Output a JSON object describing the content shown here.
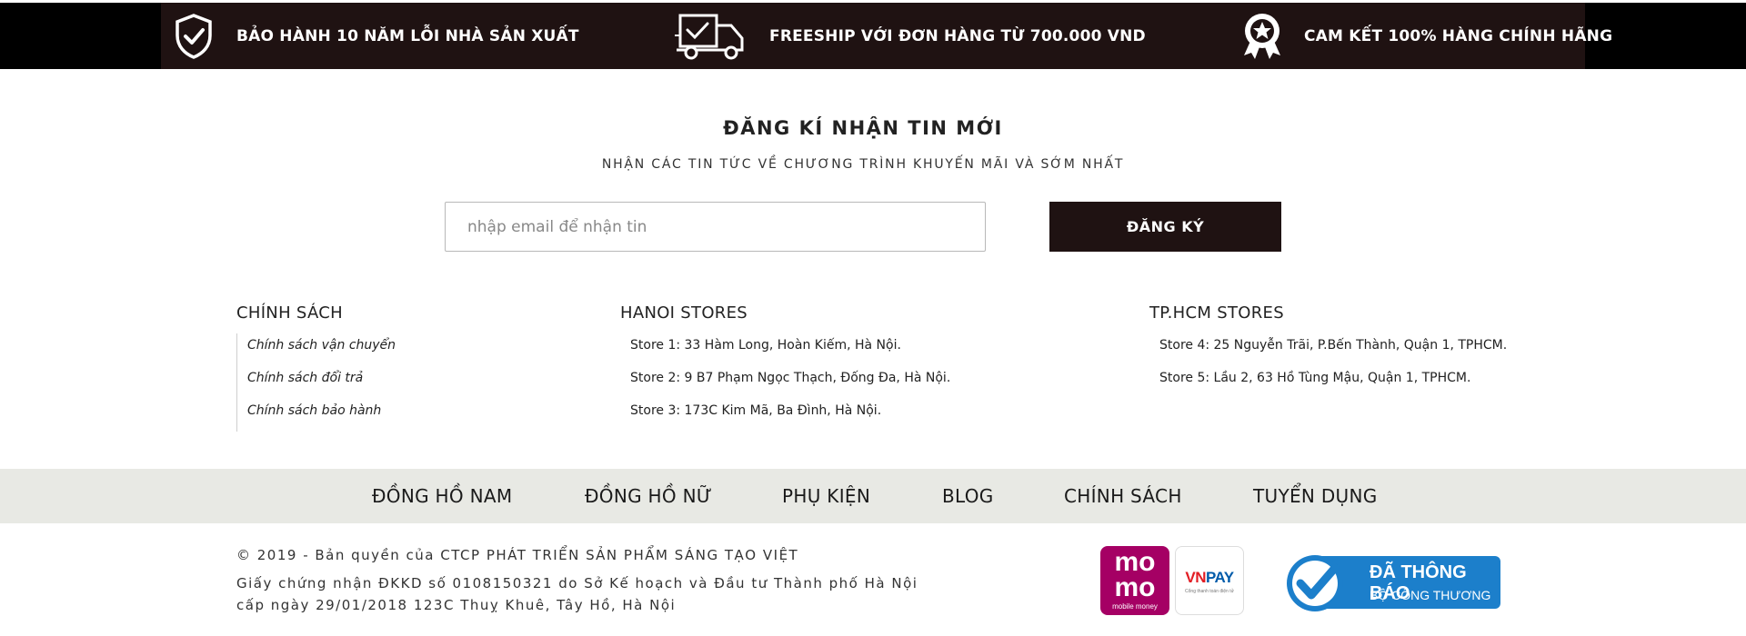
{
  "benefits": [
    {
      "icon": "shield-check-icon",
      "text": "BẢO HÀNH 10 NĂM LỖI NHÀ SẢN XUẤT"
    },
    {
      "icon": "truck-icon",
      "text": "FREESHIP VỚI ĐƠN HÀNG TỪ 700.000 VND"
    },
    {
      "icon": "award-star-icon",
      "text": "CAM KẾT 100% HÀNG CHÍNH HÃNG"
    }
  ],
  "newsletter": {
    "title": "ĐĂNG KÍ NHẬN TIN MỚI",
    "subtitle": "NHẬN CÁC TIN TỨC VỀ CHƯƠNG TRÌNH KHUYẾN MÃI VÀ SỚM NHẤT",
    "placeholder": "nhập email để nhận tin",
    "button": "ĐĂNG KÝ"
  },
  "policy": {
    "title": "CHÍNH SÁCH",
    "items": [
      "Chính sách vận chuyển",
      "Chính sách đổi trả",
      "Chính sách bảo hành"
    ]
  },
  "hanoi": {
    "title": "HANOI STORES",
    "items": [
      "Store 1: 33 Hàm Long, Hoàn Kiếm, Hà Nội.",
      "Store 2: 9 B7 Phạm Ngọc Thạch, Đống Đa, Hà Nội.",
      "Store 3: 173C Kim Mã, Ba Đình, Hà Nội."
    ]
  },
  "hcm": {
    "title": "TP.HCM STORES",
    "items": [
      "Store 4: 25 Nguyễn Trãi, P.Bến Thành, Quận 1, TPHCM.",
      "Store 5: Lầu 2, 63 Hồ Tùng Mậu, Quận 1, TPHCM."
    ]
  },
  "nav": [
    "ĐỒNG HỒ NAM",
    "ĐỒNG HỒ NỮ",
    "PHỤ KIỆN",
    "BLOG",
    "CHÍNH SÁCH",
    "TUYỂN DỤNG"
  ],
  "copyright": {
    "line1": "© 2019 - Bản quyền của CTCP PHÁT TRIỂN SẢN PHẨM SÁNG TẠO VIỆT",
    "line2": "Giấy chứng nhận ĐKKD số 0108150321 do Sở Kế hoạch và Đầu tư Thành phố Hà Nội",
    "line3": "cấp ngày 29/01/2018 123C Thuỵ Khuê, Tây Hồ, Hà Nội"
  },
  "payments": {
    "momo_top": "mo",
    "momo_bottom": "mo",
    "momo_caption": "mobile money",
    "vnpay_vn": "VN",
    "vnpay_pay": "PAY",
    "vnpay_caption": "Cổng thanh toán điện tử",
    "bct_line1": "ĐÃ THÔNG BÁO",
    "bct_line2": "BỘ CÔNG THƯƠNG",
    "bct_ring": "ONLINE.GOV.VN"
  },
  "colors": {
    "dark_bar": "#1f1212",
    "nav_bg": "#e8e9e4",
    "momo": "#a50064",
    "vnpay_red": "#e21d24",
    "vnpay_blue": "#005baa",
    "bct_blue": "#1c7fcb"
  }
}
